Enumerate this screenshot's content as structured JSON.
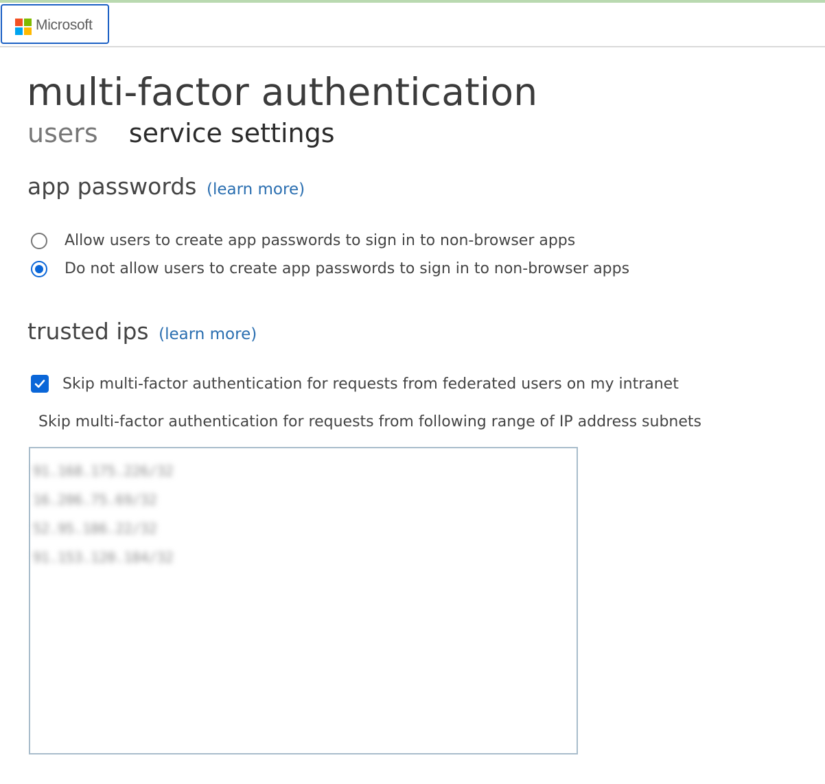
{
  "header": {
    "logo_text": "Microsoft",
    "logo_colors": [
      "#f25022",
      "#7fba00",
      "#00a4ef",
      "#ffb900"
    ]
  },
  "page": {
    "title": "multi-factor authentication",
    "tabs": [
      {
        "label": "users",
        "active": false
      },
      {
        "label": "service settings",
        "active": true
      }
    ]
  },
  "app_passwords": {
    "title": "app passwords",
    "learn_more": "(learn more)",
    "options": [
      {
        "label": "Allow users to create app passwords to sign in to non-browser apps",
        "selected": false
      },
      {
        "label": "Do not allow users to create app passwords to sign in to non-browser apps",
        "selected": true
      }
    ]
  },
  "trusted_ips": {
    "title": "trusted ips",
    "learn_more": "(learn more)",
    "federated_checkbox": {
      "label": "Skip multi-factor authentication for requests from federated users on my intranet",
      "checked": true
    },
    "subnets_label": "Skip multi-factor authentication for requests from following range of IP address subnets",
    "subnets": [
      "91.168.175.226/32",
      "16.206.75.69/32",
      "52.95.186.22/32",
      "91.153.120.184/32"
    ]
  },
  "colors": {
    "accent": "#0a66d8",
    "link": "#2a6eb0",
    "logo_border": "#1a5fc4"
  }
}
